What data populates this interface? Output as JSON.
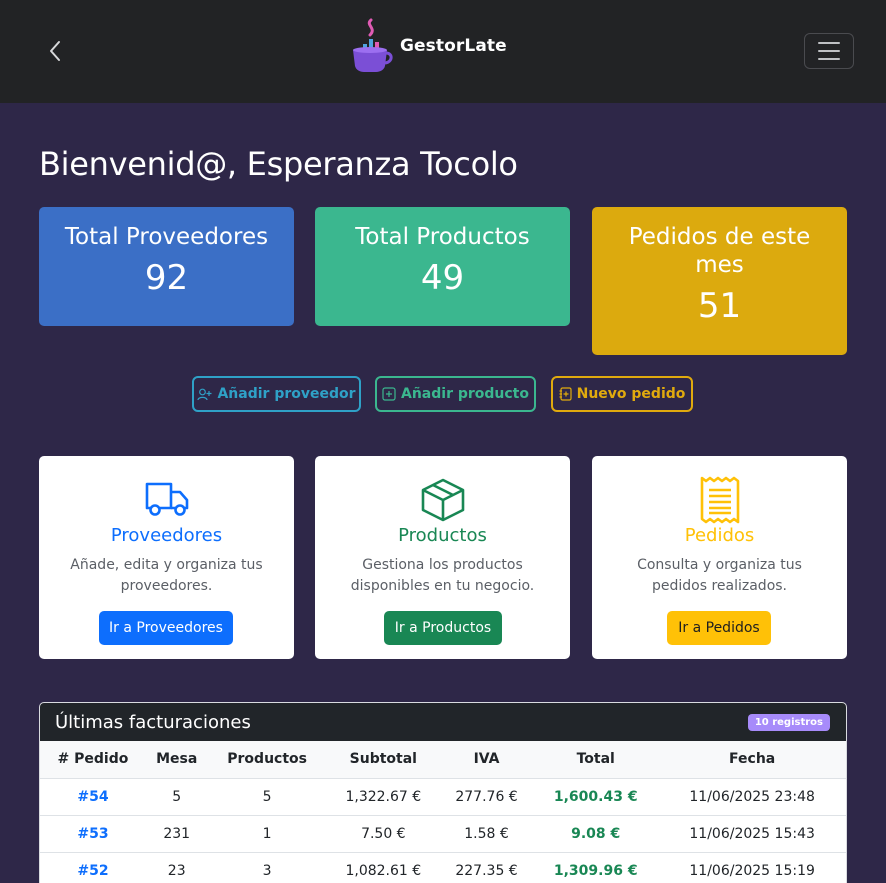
{
  "navbar": {
    "brand": "GestorLate",
    "back_icon": "chevron-left-icon",
    "menu_icon": "hamburger-icon"
  },
  "welcome": "Bienvenid@, Esperanza Tocolo",
  "stats": [
    {
      "label": "Total Proveedores",
      "value": "92",
      "color": "#3b6fc6"
    },
    {
      "label": "Total Productos",
      "value": "49",
      "color": "#3bb78f"
    },
    {
      "label": "Pedidos de este mes",
      "value": "51",
      "color": "#dcaa0e"
    }
  ],
  "quick_actions": [
    {
      "label": "Añadir proveedor",
      "icon": "person-plus-icon",
      "color": "#2fa1c7"
    },
    {
      "label": "Añadir producto",
      "icon": "plus-square-icon",
      "color": "#3bb78f"
    },
    {
      "label": "Nuevo pedido",
      "icon": "journal-plus-icon",
      "color": "#e0aa0e"
    }
  ],
  "cards": [
    {
      "title": "Proveedores",
      "text": "Añade, edita y organiza tus proveedores.",
      "button": "Ir a Proveedores",
      "icon": "truck-icon",
      "color": "#0d6efd"
    },
    {
      "title": "Productos",
      "text": "Gestiona los productos disponibles en tu negocio.",
      "button": "Ir a Productos",
      "icon": "box-icon",
      "color": "#198754"
    },
    {
      "title": "Pedidos",
      "text": "Consulta y organiza tus pedidos realizados.",
      "button": "Ir a Pedidos",
      "icon": "receipt-icon",
      "color": "#ffc107"
    }
  ],
  "table": {
    "title": "Últimas facturaciones",
    "badge": "10 registros",
    "headers": [
      "# Pedido",
      "Mesa",
      "Productos",
      "Subtotal",
      "IVA",
      "Total",
      "Fecha"
    ],
    "rows": [
      {
        "pedido": "#54",
        "mesa": "5",
        "productos": "5",
        "subtotal": "1,322.67 €",
        "iva": "277.76 €",
        "total": "1,600.43 €",
        "fecha": "11/06/2025 23:48"
      },
      {
        "pedido": "#53",
        "mesa": "231",
        "productos": "1",
        "subtotal": "7.50 €",
        "iva": "1.58 €",
        "total": "9.08 €",
        "fecha": "11/06/2025 15:43"
      },
      {
        "pedido": "#52",
        "mesa": "23",
        "productos": "3",
        "subtotal": "1,082.61 €",
        "iva": "227.35 €",
        "total": "1,309.96 €",
        "fecha": "11/06/2025 15:19"
      }
    ]
  }
}
